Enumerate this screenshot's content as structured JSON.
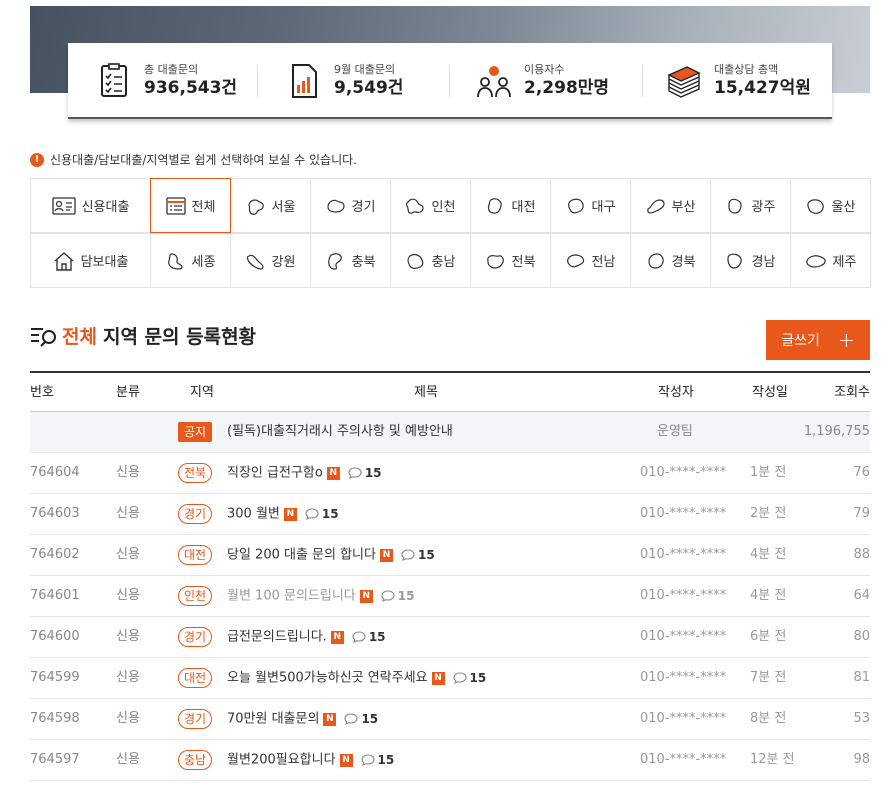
{
  "stats": [
    {
      "label": "총 대출문의",
      "value": "936,543건",
      "icon": "checklist-icon"
    },
    {
      "label": "9월 대출문의",
      "value": "9,549건",
      "icon": "bar-chart-icon"
    },
    {
      "label": "이용자수",
      "value": "2,298만명",
      "icon": "users-icon"
    },
    {
      "label": "대출상담 총액",
      "value": "15,427억원",
      "icon": "money-stack-icon"
    }
  ],
  "notice_text": "신용대출/담보대출/지역별로 쉽게 선택하여 보실 수 있습니다.",
  "categories": {
    "credit": "신용대출",
    "collateral": "담보대출",
    "regions": [
      "전체",
      "서울",
      "경기",
      "인천",
      "대전",
      "대구",
      "부산",
      "광주",
      "울산",
      "세종",
      "강원",
      "충북",
      "충남",
      "전북",
      "전남",
      "경북",
      "경남",
      "제주"
    ],
    "selected": "전체"
  },
  "section": {
    "highlight": "전체",
    "title": "지역 문의 등록현황",
    "write_label": "글쓰기",
    "write_plus": "+"
  },
  "table": {
    "headers": {
      "no": "번호",
      "type": "분류",
      "region": "지역",
      "title": "제목",
      "author": "작성자",
      "date": "작성일",
      "views": "조회수"
    },
    "notice": {
      "tag": "공지",
      "title": "(필독)대출직거래시 주의사항 및 예방안내",
      "author": "운영팀",
      "views": "1,196,755"
    },
    "rows": [
      {
        "no": "764604",
        "type": "신용",
        "region": "전북",
        "title": "직장인 급전구함o",
        "new": "N",
        "comments": "15",
        "author": "010-****-****",
        "date": "1분 전",
        "views": "76"
      },
      {
        "no": "764603",
        "type": "신용",
        "region": "경기",
        "title": "300 월변",
        "new": "N",
        "comments": "15",
        "author": "010-****-****",
        "date": "2분 전",
        "views": "79"
      },
      {
        "no": "764602",
        "type": "신용",
        "region": "대전",
        "title": "당일 200 대출 문의 합니다",
        "new": "N",
        "comments": "15",
        "author": "010-****-****",
        "date": "4분 전",
        "views": "88"
      },
      {
        "no": "764601",
        "type": "신용",
        "region": "인천",
        "title": "월변 100 문의드립니다",
        "new": "N",
        "comments": "15",
        "author": "010-****-****",
        "date": "4분 전",
        "views": "64",
        "muted": true
      },
      {
        "no": "764600",
        "type": "신용",
        "region": "경기",
        "title": "급전문의드립니다.",
        "new": "N",
        "comments": "15",
        "author": "010-****-****",
        "date": "6분 전",
        "views": "80"
      },
      {
        "no": "764599",
        "type": "신용",
        "region": "대전",
        "title": "오늘 월변500가능하신곳 연락주세요",
        "new": "N",
        "comments": "15",
        "author": "010-****-****",
        "date": "7분 전",
        "views": "81"
      },
      {
        "no": "764598",
        "type": "신용",
        "region": "경기",
        "title": "70만원 대출문의",
        "new": "N",
        "comments": "15",
        "author": "010-****-****",
        "date": "8분 전",
        "views": "53"
      },
      {
        "no": "764597",
        "type": "신용",
        "region": "충남",
        "title": "월변200필요합니다",
        "new": "N",
        "comments": "15",
        "author": "010-****-****",
        "date": "12분 전",
        "views": "98"
      }
    ]
  },
  "colors": {
    "accent": "#e8581a",
    "header_border": "#333333",
    "notice_row_bg": "#f3f5f8"
  }
}
